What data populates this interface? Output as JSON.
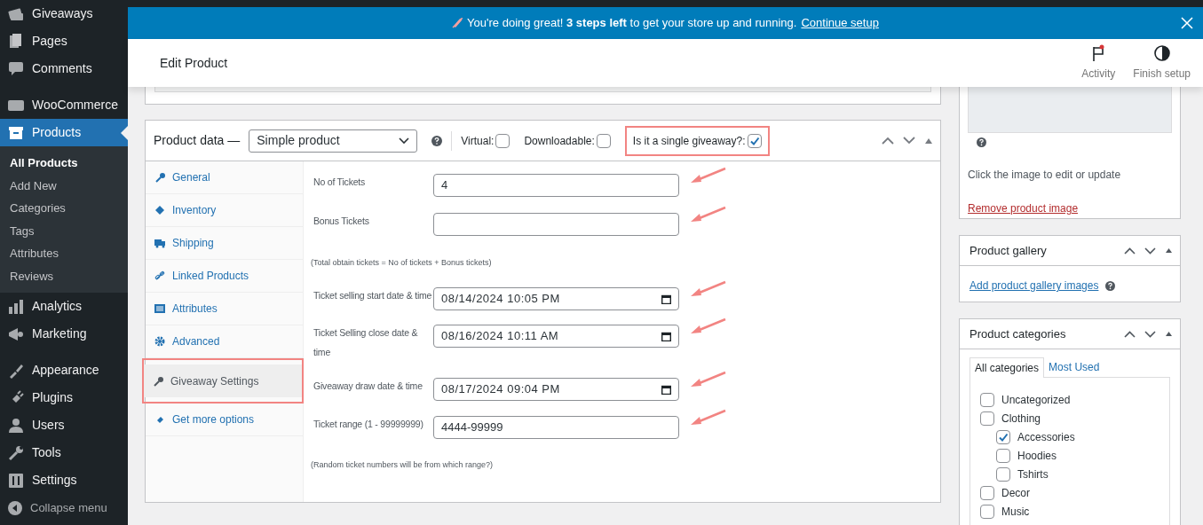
{
  "admin_menu": {
    "groups": [
      [
        {
          "label": "Giveaways",
          "selected": false
        },
        {
          "label": "Pages",
          "selected": false
        },
        {
          "label": "Comments",
          "selected": false
        }
      ],
      [
        {
          "label": "WooCommerce",
          "selected": false
        },
        {
          "label": "Products",
          "selected": true,
          "children": [
            {
              "label": "All Products",
              "selected": true
            },
            {
              "label": "Add New",
              "selected": false
            },
            {
              "label": "Categories",
              "selected": false
            },
            {
              "label": "Tags",
              "selected": false
            },
            {
              "label": "Attributes",
              "selected": false
            },
            {
              "label": "Reviews",
              "selected": false
            }
          ]
        },
        {
          "label": "Analytics",
          "selected": false
        },
        {
          "label": "Marketing",
          "selected": false
        }
      ],
      [
        {
          "label": "Appearance",
          "selected": false
        },
        {
          "label": "Plugins",
          "selected": false
        },
        {
          "label": "Users",
          "selected": false
        },
        {
          "label": "Tools",
          "selected": false
        },
        {
          "label": "Settings",
          "selected": false
        }
      ]
    ],
    "collapse": "Collapse menu"
  },
  "notice": {
    "text": "You're doing great! **3 steps left** to get your store up and running.",
    "link": "Continue setup"
  },
  "header": {
    "title": "Edit Product",
    "actions": [
      {
        "label": "Activity"
      },
      {
        "label": "Finish setup"
      }
    ]
  },
  "product_data": {
    "title": "Product data —",
    "type": "Simple product",
    "options": [
      {
        "label": "Virtual:",
        "checked": false,
        "highlighted": false
      },
      {
        "label": "Downloadable:",
        "checked": false,
        "highlighted": false
      },
      {
        "label": "Is it a single giveaway?:",
        "checked": true,
        "highlighted": true
      }
    ],
    "tabs": [
      {
        "label": "General",
        "selected": false,
        "highlighted": false
      },
      {
        "label": "Inventory",
        "selected": false,
        "highlighted": false
      },
      {
        "label": "Shipping",
        "selected": false,
        "highlighted": false
      },
      {
        "label": "Linked Products",
        "selected": false,
        "highlighted": false
      },
      {
        "label": "Attributes",
        "selected": false,
        "highlighted": false
      },
      {
        "label": "Advanced",
        "selected": false,
        "highlighted": false
      },
      {
        "label": "Giveaway Settings",
        "selected": true,
        "highlighted": true
      },
      {
        "label": "Get more options",
        "selected": false,
        "highlighted": false
      }
    ],
    "fields": [
      {
        "kind": "text",
        "label": "No of Tickets",
        "value": "4"
      },
      {
        "kind": "text",
        "label": "Bonus Tickets"
      },
      {
        "kind": "note",
        "text": "(Total obtain tickets = No of tickets + Bonus tickets)"
      },
      {
        "kind": "datetime",
        "label": "Ticket selling start date & time",
        "value": "08/14/2024 10:05 PM"
      },
      {
        "kind": "datetime",
        "label": "Ticket Selling close date & time",
        "value": "08/16/2024 10:11 AM"
      },
      {
        "kind": "datetime",
        "label": "Giveaway draw date & time",
        "value": "08/17/2024 09:04 PM"
      },
      {
        "kind": "text",
        "label": "Ticket range (1 - 99999999)",
        "value": "4444-99999"
      },
      {
        "kind": "note",
        "text": "(Random ticket numbers will be from which range?)"
      }
    ]
  },
  "product_image": {
    "hint": "Click the image to edit or update",
    "remove_link": "Remove product image"
  },
  "product_gallery": {
    "title": "Product gallery",
    "link": "Add product gallery images"
  },
  "product_categories": {
    "title": "Product categories",
    "tabs": [
      {
        "label": "All categories",
        "selected": true
      },
      {
        "label": "Most Used",
        "selected": false
      }
    ],
    "items": [
      {
        "label": "Uncategorized",
        "checked": false
      },
      {
        "label": "Clothing",
        "checked": false,
        "children": [
          {
            "label": "Accessories",
            "checked": true
          },
          {
            "label": "Hoodies",
            "checked": false
          },
          {
            "label": "Tshirts",
            "checked": false
          }
        ]
      },
      {
        "label": "Decor",
        "checked": false
      },
      {
        "label": "Music",
        "checked": false
      }
    ]
  }
}
